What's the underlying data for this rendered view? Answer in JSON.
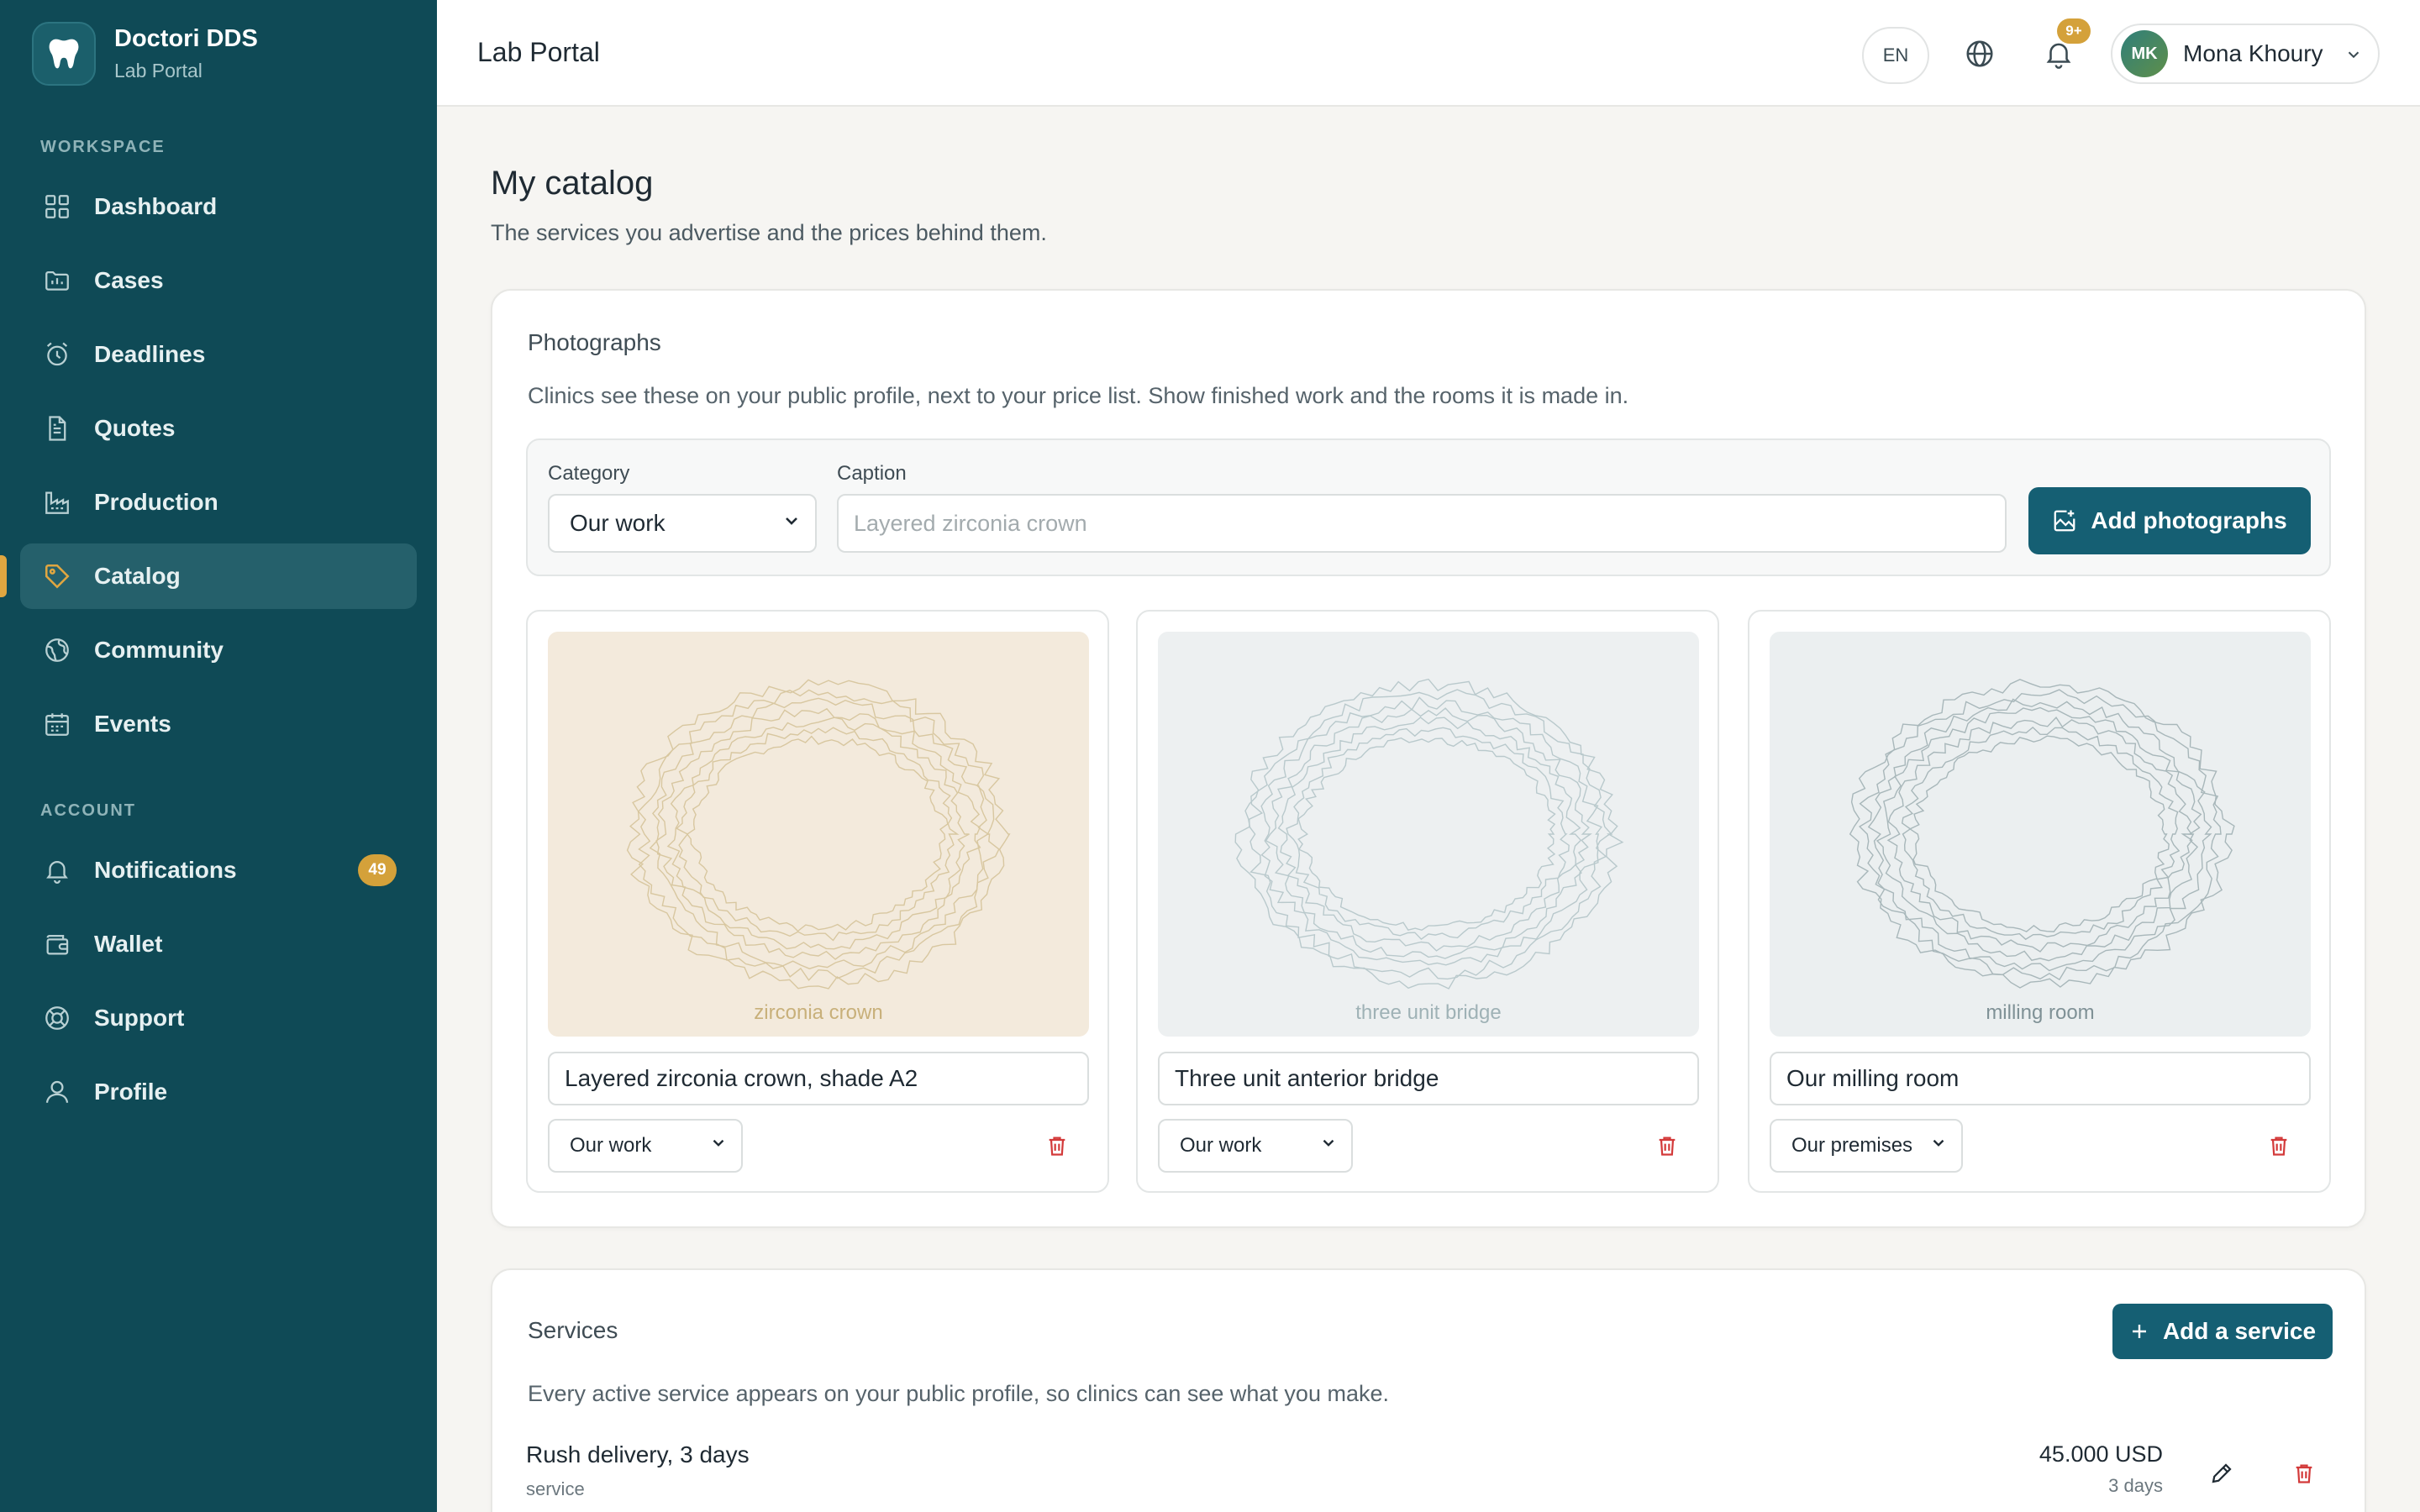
{
  "brand": {
    "name": "Doctori DDS",
    "sub": "Lab Portal"
  },
  "sidebar": {
    "workspace_label": "WORKSPACE",
    "account_label": "ACCOUNT",
    "workspace_items": [
      {
        "label": "Dashboard",
        "icon": "grid-icon"
      },
      {
        "label": "Cases",
        "icon": "folder-icon"
      },
      {
        "label": "Deadlines",
        "icon": "alarm-clock-icon"
      },
      {
        "label": "Quotes",
        "icon": "document-icon"
      },
      {
        "label": "Production",
        "icon": "factory-icon"
      },
      {
        "label": "Catalog",
        "icon": "tag-icon",
        "active": true
      },
      {
        "label": "Community",
        "icon": "globe-icon"
      },
      {
        "label": "Events",
        "icon": "calendar-icon"
      }
    ],
    "account_items": [
      {
        "label": "Notifications",
        "icon": "bell-icon",
        "badge": "49"
      },
      {
        "label": "Wallet",
        "icon": "wallet-icon"
      },
      {
        "label": "Support",
        "icon": "lifebuoy-icon"
      },
      {
        "label": "Profile",
        "icon": "user-icon"
      }
    ]
  },
  "topbar": {
    "title": "Lab Portal",
    "lang": "EN",
    "notif_badge": "9+",
    "user": {
      "initials": "MK",
      "name": "Mona Khoury"
    }
  },
  "page": {
    "title": "My catalog",
    "subtitle": "The services you advertise and the prices behind them."
  },
  "photos": {
    "title": "Photographs",
    "description": "Clinics see these on your public profile, next to your price list. Show finished work and the rooms it is made in.",
    "category_label": "Category",
    "category_value": "Our work",
    "caption_label": "Caption",
    "caption_placeholder": "Layered zirconia crown",
    "add_button": "Add photographs",
    "items": [
      {
        "image_label": "zirconia crown",
        "caption": "Layered zirconia crown, shade A2",
        "category": "Our work",
        "bg": "#f3eadc",
        "stroke": "#d8c7a0",
        "label_color": "#c8b07a"
      },
      {
        "image_label": "three unit bridge",
        "caption": "Three unit anterior bridge",
        "category": "Our work",
        "bg": "#edf0f1",
        "stroke": "#b9c9cc",
        "label_color": "#9fb2b6"
      },
      {
        "image_label": "milling room",
        "caption": "Our milling room",
        "category": "Our premises",
        "bg": "#ebeff0",
        "stroke": "#a8b7ba",
        "label_color": "#7f9196"
      }
    ]
  },
  "services": {
    "title": "Services",
    "add_button": "Add a service",
    "description": "Every active service appears on your public profile, so clinics can see what you make.",
    "rows": [
      {
        "name": "Rush delivery, 3 days",
        "type": "service",
        "price": "45.000 USD",
        "duration": "3 days"
      }
    ]
  },
  "colors": {
    "sidebar_bg": "#0f4a56",
    "accent": "#155f73",
    "badge": "#d4a13a",
    "danger": "#d33a3a"
  }
}
